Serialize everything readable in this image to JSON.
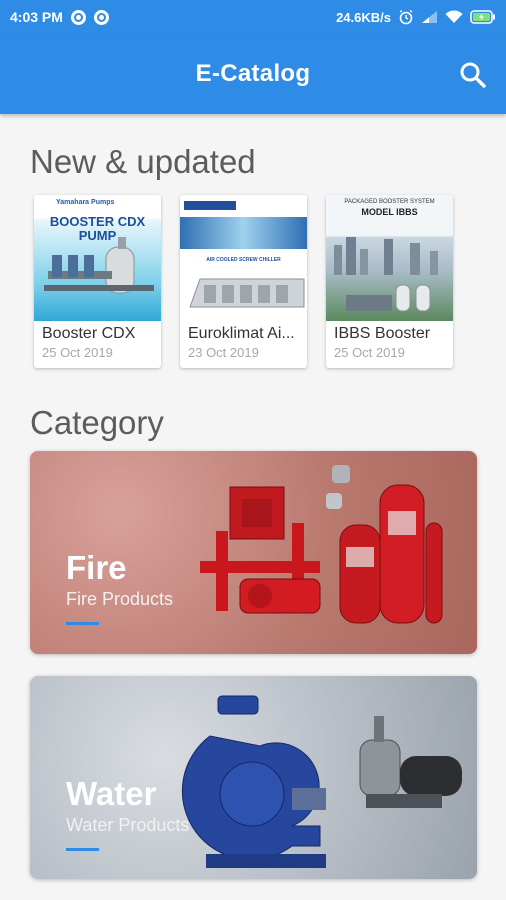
{
  "status": {
    "time": "4:03 PM",
    "net_speed": "24.6KB/s"
  },
  "app": {
    "title": "E-Catalog",
    "accent_color": "#2f8ce6"
  },
  "sections": {
    "new_title": "New & updated",
    "category_title": "Category"
  },
  "catalogs": [
    {
      "name": "Booster CDX",
      "date": "25 Oct 2019",
      "thumb_heading": "BOOSTER CDX PUMP",
      "thumb_logo": "Yamahara Pumps"
    },
    {
      "name": "Euroklimat Ai...",
      "date": "23 Oct 2019",
      "thumb_heading": "AIR COOLED SCREW CHILLER",
      "thumb_logo": "EUROKLIMAT"
    },
    {
      "name": "IBBS Booster",
      "date": "25 Oct 2019",
      "thumb_heading": "MODEL IBBS",
      "thumb_caption": "PACKAGED BOOSTER SYSTEM"
    }
  ],
  "categories": [
    {
      "title": "Fire",
      "subtitle": "Fire Products"
    },
    {
      "title": "Water",
      "subtitle": "Water Products"
    }
  ],
  "icons": {
    "search": "search-icon",
    "alarm": "alarm-icon",
    "signal": "signal-icon",
    "wifi": "wifi-icon",
    "battery": "battery-charging-icon"
  }
}
